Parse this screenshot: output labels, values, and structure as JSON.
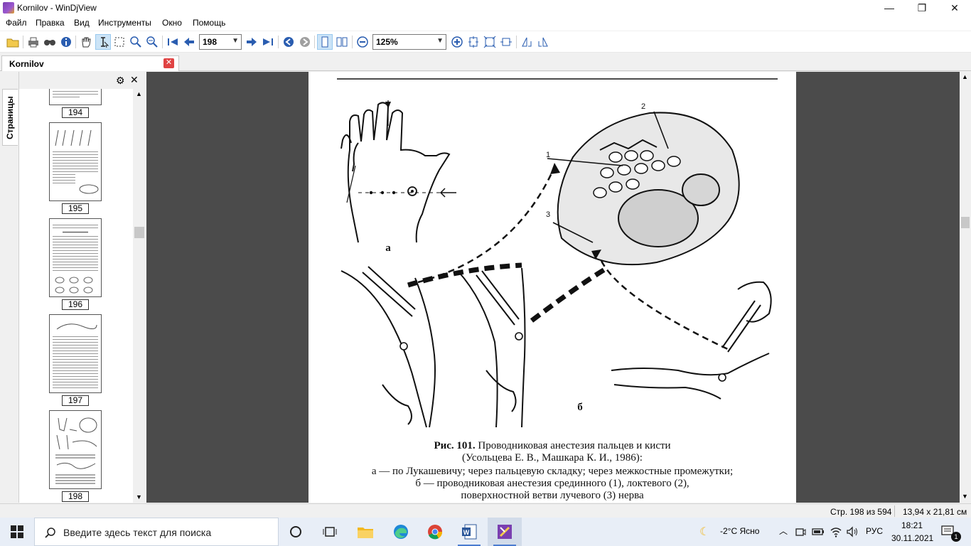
{
  "window": {
    "title": "Kornilov - WinDjView",
    "minimize": "—",
    "maximize": "❐",
    "close": "✕"
  },
  "menu": [
    "Файл",
    "Правка",
    "Вид",
    "Инструменты",
    "Окно",
    "Помощь"
  ],
  "toolbar": {
    "page_value": "198",
    "zoom_value": "125%",
    "icons": [
      "open-icon",
      "print-icon",
      "find-icon",
      "info-icon",
      "hand-icon",
      "select-text-icon",
      "select-rect-icon",
      "zoom-in-tool-icon",
      "zoom-out-tool-icon",
      "first-page-icon",
      "prev-page-icon",
      "next-page-icon",
      "last-page-icon",
      "back-icon",
      "forward-icon",
      "single-page-icon",
      "two-page-icon",
      "zoom-out-icon",
      "zoom-in-icon",
      "fit-page-icon",
      "actual-size-icon",
      "fit-width-icon",
      "rotate-left-icon",
      "rotate-right-icon"
    ]
  },
  "tab": {
    "label": "Kornilov",
    "close": "✕"
  },
  "sidebar": {
    "tab_label": "Страницы",
    "pages": [
      "194",
      "195",
      "196",
      "197",
      "198"
    ]
  },
  "document": {
    "figure_label_a": "а",
    "figure_label_b": "б",
    "callout_1": "1",
    "callout_2": "2",
    "callout_3": "3",
    "caption_bold": "Рис. 101.",
    "caption_line1": " Проводниковая анестезия пальцев и кисти",
    "caption_line2": "(Усольцева Е. В., Машкара К. И., 1986):",
    "caption_line3": "а — по Лукашевичу; через пальцевую складку; через межкостные промежутки;",
    "caption_line4": "б — проводниковая анестезия срединного (1), локтевого (2),",
    "caption_line5": "поверхностной ветви лучевого (3) нерва"
  },
  "status": {
    "page_info": "Стр. 198 из 594",
    "page_size": "13,94 x 21,81 см"
  },
  "taskbar": {
    "search_placeholder": "Введите здесь текст для поиска",
    "weather": "-2°C  Ясно",
    "language": "РУС",
    "time": "18:21",
    "date": "30.11.2021"
  },
  "colors": {
    "doc_background": "#4b4b4b",
    "tab_close": "#e04343",
    "taskbar": "#e8eef7",
    "accent": "#4a7bd0"
  }
}
